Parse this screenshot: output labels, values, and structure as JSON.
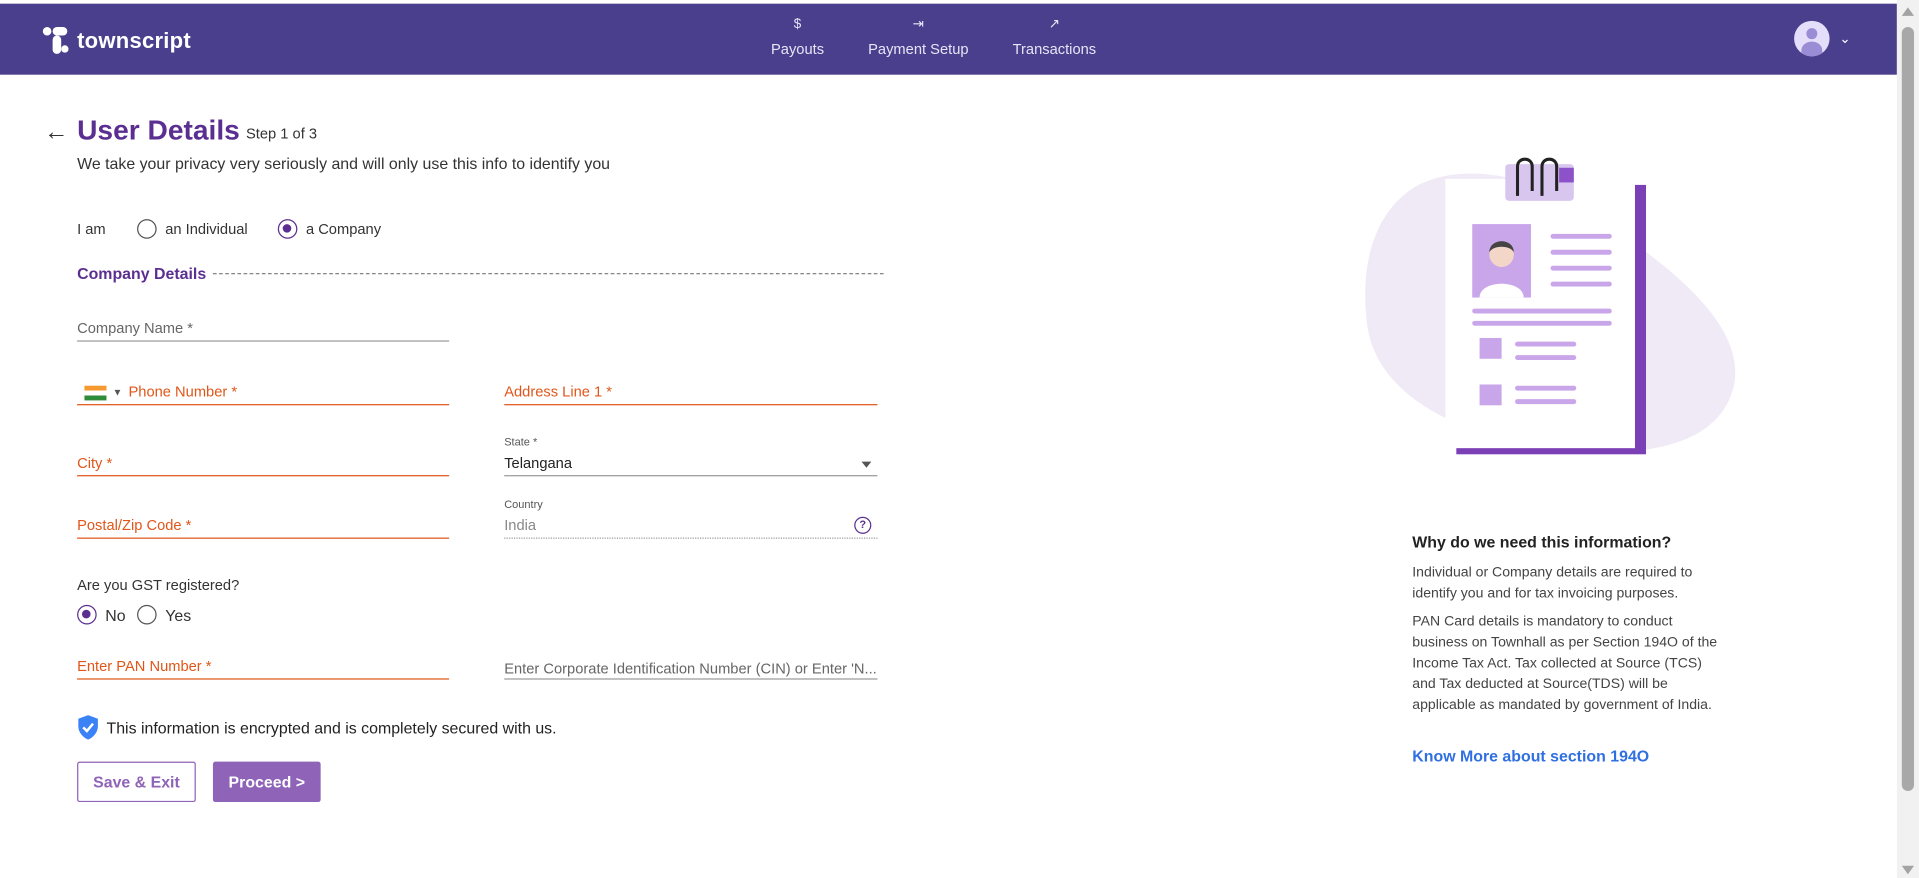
{
  "brand": {
    "name": "townscript",
    "nav_bg": "#4a3f8c",
    "accent": "#5b2f91",
    "button": "#8e63b8",
    "error": "#e0561a",
    "link": "#2f6fe0"
  },
  "nav": {
    "items": [
      {
        "label": "Payouts",
        "icon": "$"
      },
      {
        "label": "Payment Setup",
        "icon": "⇥"
      },
      {
        "label": "Transactions",
        "icon": "↗"
      }
    ]
  },
  "header": {
    "title": "User Details",
    "step": "Step 1 of 3",
    "subtitle": "We take your privacy very seriously and will only use this info to identify you"
  },
  "entity": {
    "label": "I am",
    "options": [
      {
        "label": "an Individual",
        "selected": false
      },
      {
        "label": "a Company",
        "selected": true
      }
    ]
  },
  "company": {
    "section_title": "Company Details",
    "company_name": {
      "placeholder": "Company Name *"
    },
    "phone": {
      "placeholder": "Phone Number *",
      "country_flag": "india-flag-icon"
    },
    "address1": {
      "placeholder": "Address Line 1 *"
    },
    "city": {
      "placeholder": "City *"
    },
    "state": {
      "label": "State *",
      "value": "Telangana"
    },
    "postal": {
      "placeholder": "Postal/Zip Code *"
    },
    "country": {
      "label": "Country",
      "value": "India"
    }
  },
  "gst": {
    "question": "Are you GST registered?",
    "options": [
      {
        "label": "No",
        "selected": true
      },
      {
        "label": "Yes",
        "selected": false
      }
    ]
  },
  "pan": {
    "placeholder": "Enter PAN Number *"
  },
  "cin": {
    "placeholder": "Enter Corporate Identification Number (CIN) or Enter 'N..."
  },
  "secure_note": "This information is encrypted and is completely secured with us.",
  "buttons": {
    "save_exit": "Save & Exit",
    "proceed": "Proceed >"
  },
  "info": {
    "title": "Why do we need this information?",
    "p1": "Individual or Company details are required to identify you and for tax invoicing purposes.",
    "p2": "PAN Card details is mandatory to conduct business on Townhall as per Section 194O of the Income Tax Act. Tax collected at Source (TCS) and Tax deducted at Source(TDS) will be applicable as mandated by government of India.",
    "link": "Know More about section 194O"
  }
}
